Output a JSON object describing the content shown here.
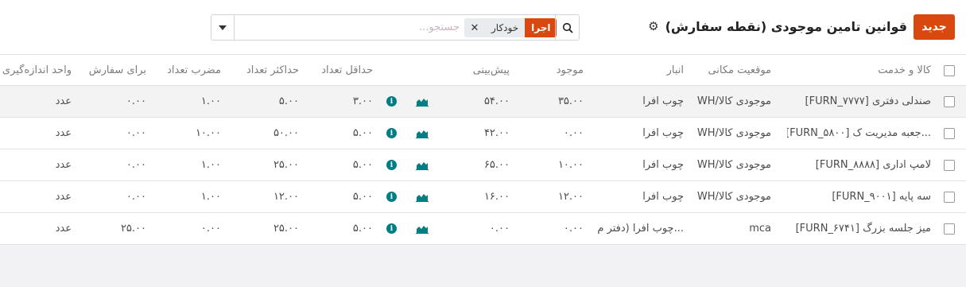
{
  "header": {
    "new_label": "جدید",
    "title": "قوانین تامین موجودی (نقطه سفارش)",
    "gear_icon": "gear-icon"
  },
  "search": {
    "placeholder": "جستجو...",
    "facet_category": "اجرا",
    "facet_value": "خودکار"
  },
  "columns": {
    "product": "کالا و خدمت",
    "location": "موقعیت مکانی",
    "warehouse": "انبار",
    "on_hand": "موجود",
    "forecast": "پیش‌بینی",
    "min_qty": "حداقل تعداد",
    "max_qty": "حداکثر تعداد",
    "multiple": "مضرب تعداد",
    "to_order": "برای سفارش",
    "uom": "واحد اندازه‌گیری"
  },
  "rows": [
    {
      "product": "[FURN_۷۷۷۷] صندلی دفتری",
      "location": "WH/موجودی کالا",
      "warehouse": "چوب افرا",
      "on_hand": "۳۵.۰۰",
      "forecast": "۵۴.۰۰",
      "min_qty": "۳.۰۰",
      "max_qty": "۵.۰۰",
      "multiple": "۱.۰۰",
      "to_order": "۰.۰۰",
      "uom": "عدد"
    },
    {
      "product": "[FURN_۵۸۰۰] جعبه مدیریت ک...",
      "location": "WH/موجودی کالا",
      "warehouse": "چوب افرا",
      "on_hand": "۰.۰۰",
      "forecast": "۴۲.۰۰",
      "min_qty": "۵.۰۰",
      "max_qty": "۵۰.۰۰",
      "multiple": "۱۰.۰۰",
      "to_order": "۰.۰۰",
      "uom": "عدد"
    },
    {
      "product": "[FURN_۸۸۸۸] لامپ اداری",
      "location": "WH/موجودی کالا",
      "warehouse": "چوب افرا",
      "on_hand": "۱۰.۰۰",
      "forecast": "۶۵.۰۰",
      "min_qty": "۵.۰۰",
      "max_qty": "۲۵.۰۰",
      "multiple": "۱.۰۰",
      "to_order": "۰.۰۰",
      "uom": "عدد"
    },
    {
      "product": "[FURN_۹۰۰۱] سه پایه",
      "location": "WH/موجودی کالا",
      "warehouse": "چوب افرا",
      "on_hand": "۱۲.۰۰",
      "forecast": "۱۶.۰۰",
      "min_qty": "۵.۰۰",
      "max_qty": "۱۲.۰۰",
      "multiple": "۱.۰۰",
      "to_order": "۰.۰۰",
      "uom": "عدد"
    },
    {
      "product": "[FURN_۶۷۴۱] میز جلسه بزرگ",
      "location": "mca",
      "warehouse": "چوب افرا (دفتر م...",
      "on_hand": "۰.۰۰",
      "forecast": "۰.۰۰",
      "min_qty": "۵.۰۰",
      "max_qty": "۲۵.۰۰",
      "multiple": "۰.۰۰",
      "to_order": "۲۵.۰۰",
      "uom": "عدد"
    }
  ],
  "icons": {
    "forecast_chart": "area-chart-icon",
    "info": "info-circle-icon",
    "search": "search-icon",
    "dropdown": "caret-down-icon",
    "remove_facet": "close-icon"
  },
  "colors": {
    "accent": "#d9480f",
    "teal": "#017e84"
  }
}
